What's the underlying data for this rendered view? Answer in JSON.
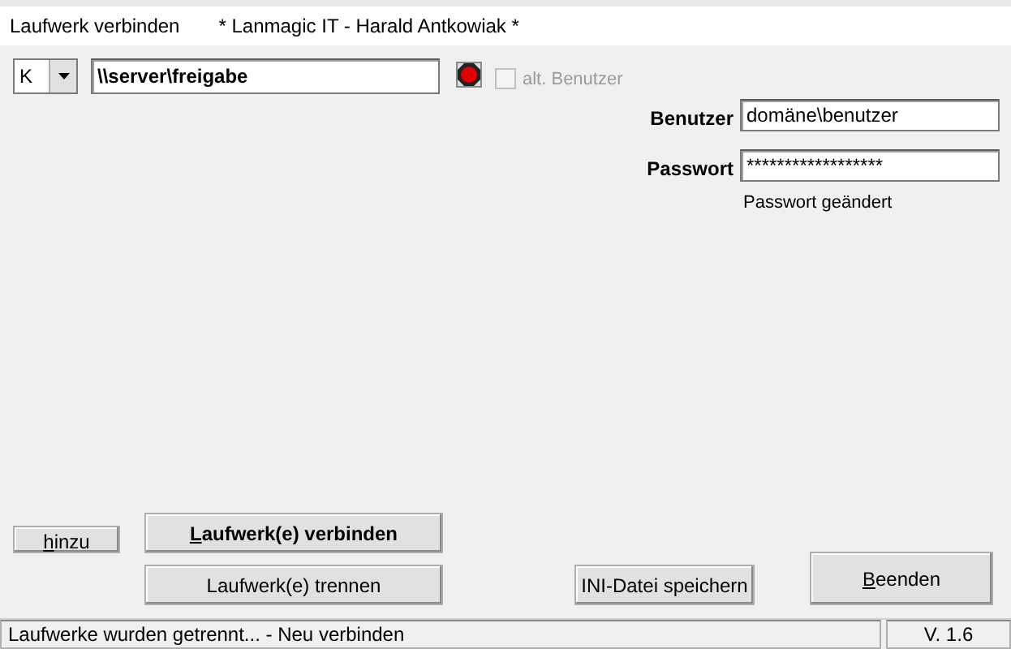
{
  "window": {
    "title": "Laufwerk verbinden",
    "subtitle": "* Lanmagic IT -  Harald Antkowiak *"
  },
  "drive": {
    "value": "K",
    "path": "\\\\server\\freigabe",
    "connected": false
  },
  "alt_user": {
    "label": "alt. Benutzer",
    "checked": false,
    "disabled": true
  },
  "credentials": [
    {
      "label": "Benutzer",
      "value": "domäne\\benutzer"
    },
    {
      "label": "Passwort",
      "value": "******************"
    }
  ],
  "password_note": "Passwort geändert",
  "buttons": [
    {
      "label": "hinzu",
      "underline_first": true,
      "bold": false
    },
    {
      "label": "Laufwerk(e) verbinden",
      "underline_first": true,
      "bold": true
    },
    {
      "label": "Laufwerk(e) trennen",
      "underline_first": false,
      "bold": false
    },
    {
      "label": "INI-Datei speichern",
      "underline_first": false,
      "bold": false
    },
    {
      "label": "Beenden",
      "underline_first": true,
      "bold": false
    }
  ],
  "status_bar": {
    "message": "Laufwerke wurden getrennt... - Neu verbinden",
    "version": "V. 1.6"
  }
}
